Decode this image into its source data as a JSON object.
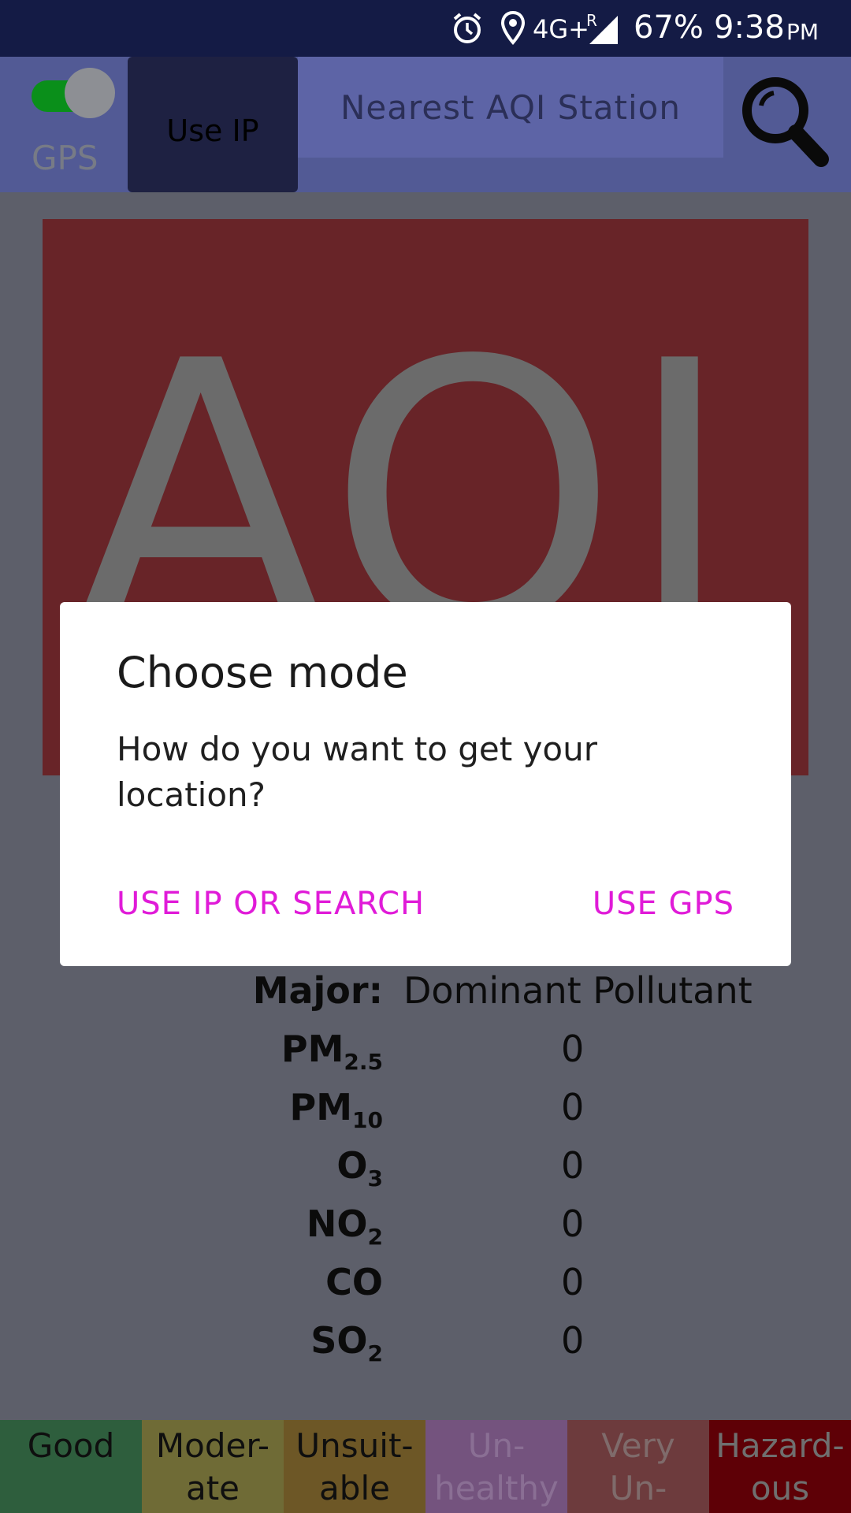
{
  "status_bar": {
    "network": "4G+",
    "roaming": "R",
    "battery": "67%",
    "time": "9:38",
    "ampm": "PM",
    "icons": [
      "alarm-icon",
      "location-icon",
      "signal-icon"
    ]
  },
  "top_bar": {
    "gps_toggle_on": true,
    "gps_label": "GPS",
    "use_ip_label": "Use IP",
    "search_placeholder": "Nearest AQI Station"
  },
  "aqi_panel": {
    "text": "AQI"
  },
  "pollutants": {
    "major_label": "Major:",
    "major_value": "Dominant Pollutant",
    "rows": [
      {
        "name": "PM",
        "sub": "2.5",
        "value": "0"
      },
      {
        "name": "PM",
        "sub": "10",
        "value": "0"
      },
      {
        "name": "O",
        "sub": "3",
        "value": "0"
      },
      {
        "name": "NO",
        "sub": "2",
        "value": "0"
      },
      {
        "name": "CO",
        "sub": "",
        "value": "0"
      },
      {
        "name": "SO",
        "sub": "2",
        "value": "0"
      }
    ]
  },
  "legend": [
    {
      "line1": "Good",
      "line2": "",
      "bg": "#2e5e3d",
      "fg": "#0f0f0f"
    },
    {
      "line1": "Moder-",
      "line2": "ate",
      "bg": "#6f6b36",
      "fg": "#0f0f0f"
    },
    {
      "line1": "Unsuit-",
      "line2": "able",
      "bg": "#6d5726",
      "fg": "#0f0f0f"
    },
    {
      "line1": "Un-",
      "line2": "healthy",
      "bg": "#74537e",
      "fg": "#8a6f94"
    },
    {
      "line1": "Very",
      "line2": "Un-",
      "bg": "#6d3b3d",
      "fg": "#7f6b6b"
    },
    {
      "line1": "Hazard-",
      "line2": "ous",
      "bg": "#5e0006",
      "fg": "#6f6f6f"
    }
  ],
  "dialog": {
    "title": "Choose mode",
    "message": "How do you want to get your location?",
    "negative_button": "USE IP OR SEARCH",
    "positive_button": "USE GPS",
    "accent_color": "#e01bd8"
  }
}
